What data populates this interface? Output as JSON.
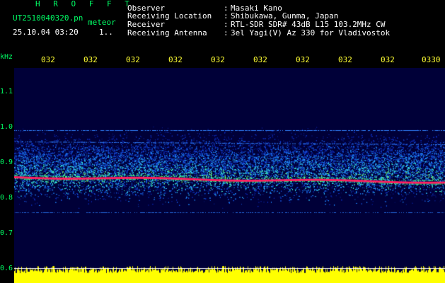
{
  "header": {
    "title": "H R O F F T",
    "filename": "UT2510040320.pn",
    "meteor_label": "meteor",
    "datetime": "25.10.04 03:20",
    "count": "1..",
    "fields": [
      {
        "label": "Observer",
        "value": "Masaki Kano"
      },
      {
        "label": "Receiving Location",
        "value": "Shibukawa, Gunma, Japan"
      },
      {
        "label": "Receiver",
        "value": "RTL-SDR SDR# 43dB L15 103.2MHz CW"
      },
      {
        "label": "Receiving Antenna",
        "value": "3el Yagi(V) Az 330 for Vladivostok"
      }
    ]
  },
  "axis": {
    "unit": "kHz",
    "y_ticks": [
      "1.1",
      "1.0",
      "0.9",
      "0.8",
      "0.7",
      "0.6"
    ],
    "x_ticks": [
      "032",
      "032",
      "032",
      "032",
      "032",
      "032",
      "032",
      "032",
      "032",
      "0330"
    ]
  },
  "colors": {
    "green_text": "#00ff66",
    "yellow_text": "#ffff33",
    "white_text": "#ffffff",
    "plot_background": "#000038",
    "carrier_line": "#ff2060",
    "baseline_fill": "#ffff00"
  }
}
